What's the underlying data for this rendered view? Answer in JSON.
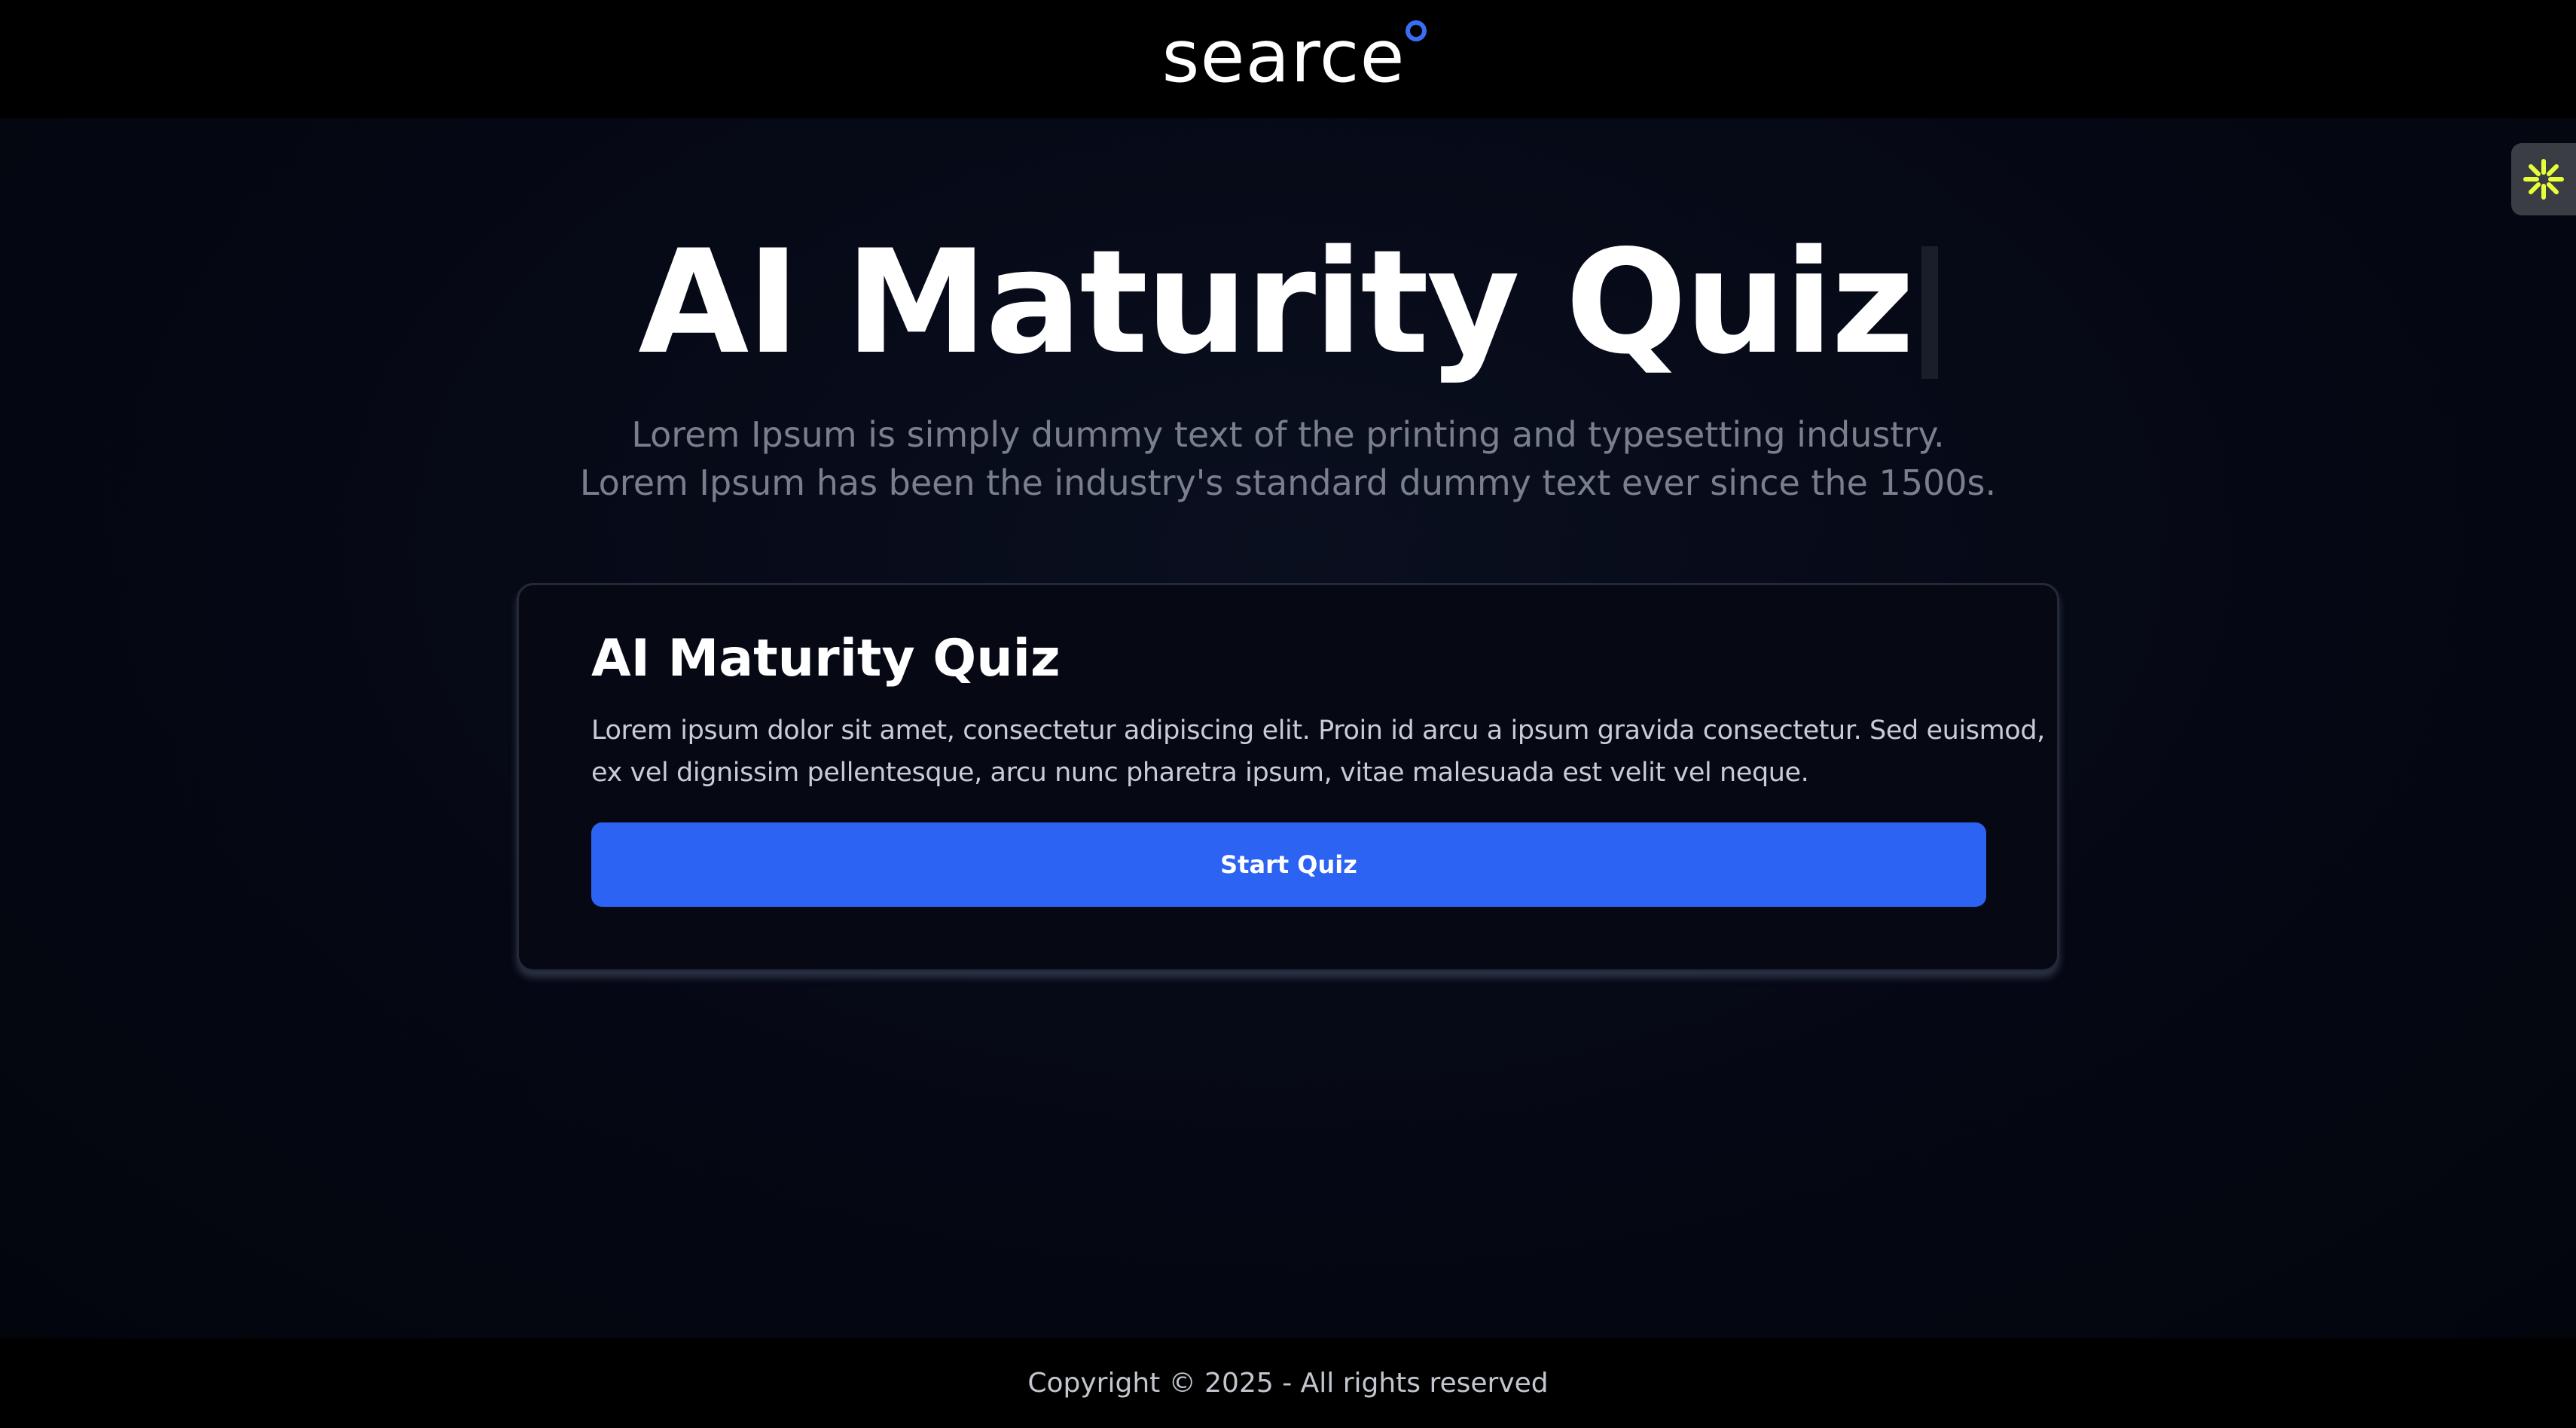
{
  "header": {
    "logo_text": "searce"
  },
  "hero": {
    "title": "AI Maturity Quiz",
    "subtitle_lines": [
      "Lorem Ipsum is simply dummy text of the printing and typesetting industry.",
      "Lorem Ipsum has been the industry's standard dummy text ever since the 1500s."
    ]
  },
  "card": {
    "title": "AI Maturity Quiz",
    "description_lines": [
      "Lorem ipsum dolor sit amet, consectetur adipiscing elit. Proin id arcu a ipsum gravida consectetur. Sed euismod,",
      "ex vel dignissim pellentesque, arcu nunc pharetra ipsum, vitae malesuada est velit vel neque."
    ],
    "button_label": "Start Quiz"
  },
  "footer": {
    "copyright": "Copyright © 2025 - All rights reserved"
  },
  "icons": {
    "extension_widget": "sparkle-icon"
  },
  "colors": {
    "accent": "#2c63f3",
    "logo_dot": "#3a6cf4",
    "widget_icon": "#e6ff3a"
  }
}
